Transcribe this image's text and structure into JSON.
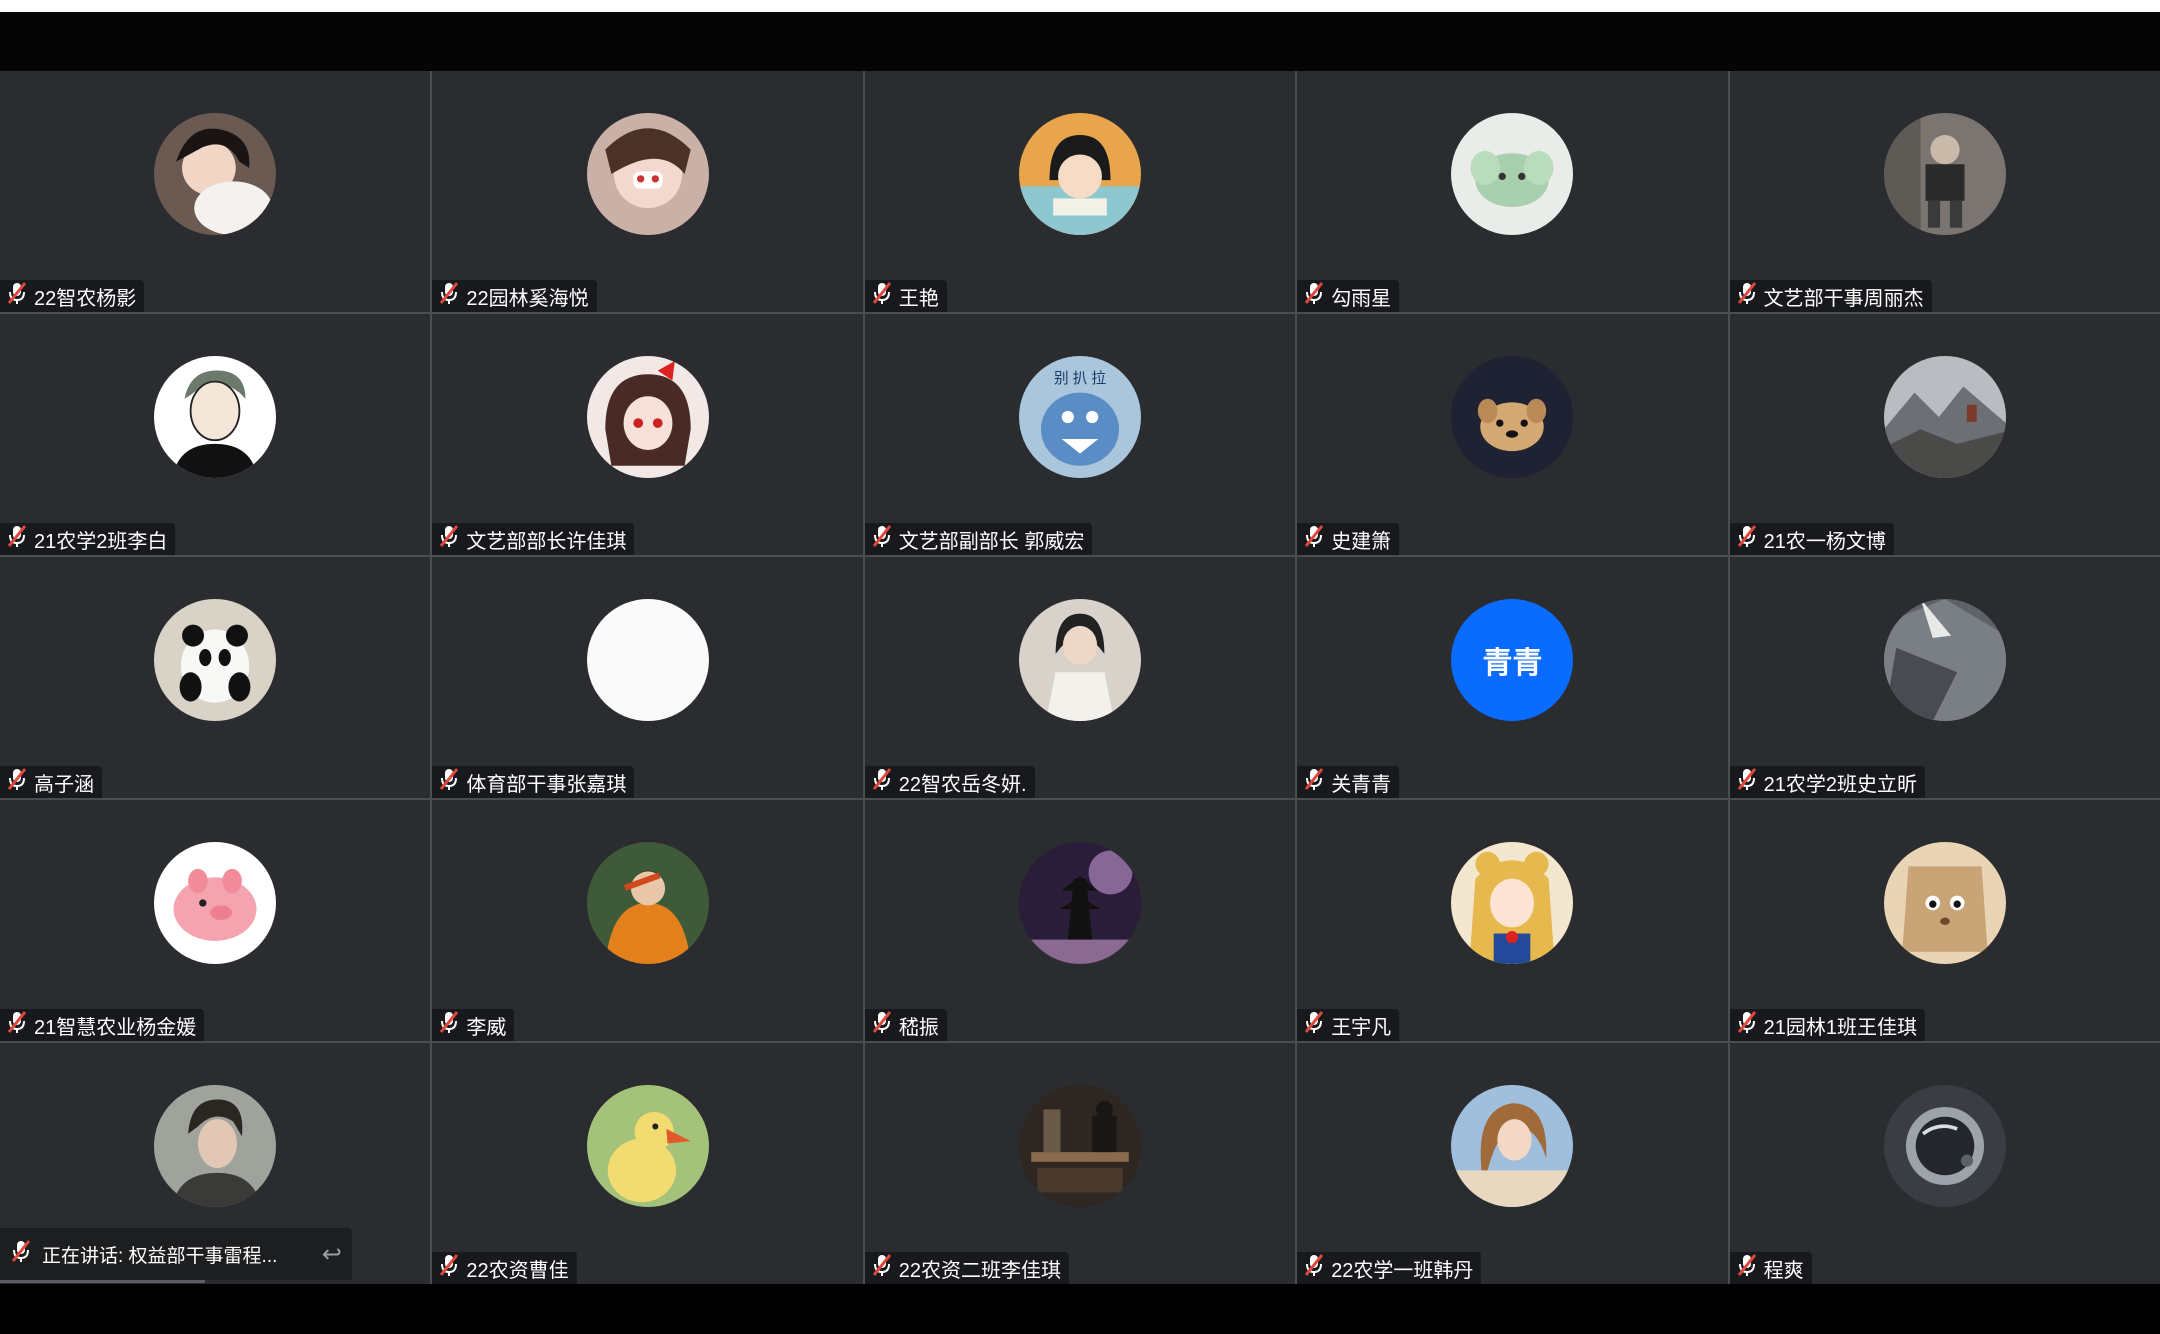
{
  "colors": {
    "tile_bg": "#2a2c30",
    "mic_muted": "#e0473c",
    "text_avatar_bg": "#0a6cff"
  },
  "participants": [
    {
      "name": "22智农杨影",
      "avatar": "photo-girl"
    },
    {
      "name": "22园林奚海悦",
      "avatar": "photo-girl-sticker"
    },
    {
      "name": "王艳",
      "avatar": "cartoon-maruko"
    },
    {
      "name": "勾雨星",
      "avatar": "cartoon-green-elephant"
    },
    {
      "name": "文艺部干事周丽杰",
      "avatar": "photo-person-sitting"
    },
    {
      "name": "21农学2班李白",
      "avatar": "cartoon-zoro"
    },
    {
      "name": "文艺部部长许佳琪",
      "avatar": "anime-girl-red-bow"
    },
    {
      "name": "文艺部副部长 郭威宏",
      "avatar": "cartoon-blue-dino"
    },
    {
      "name": "史建箫",
      "avatar": "cartoon-dark-dog"
    },
    {
      "name": "21农一杨文博",
      "avatar": "photo-mountains"
    },
    {
      "name": "高子涵",
      "avatar": "photo-panda"
    },
    {
      "name": "体育部干事张嘉琪",
      "avatar": "blank-white"
    },
    {
      "name": "22智农岳冬妍.",
      "avatar": "photo-girl-room"
    },
    {
      "name": "关青青",
      "avatar": "text",
      "avatar_text": "青青"
    },
    {
      "name": "21农学2班史立昕",
      "avatar": "photo-fabric"
    },
    {
      "name": "21智慧农业杨金媛",
      "avatar": "cartoon-pink-pig"
    },
    {
      "name": "李威",
      "avatar": "photo-orange-hoodie"
    },
    {
      "name": "嵇振",
      "avatar": "photo-pagoda-night"
    },
    {
      "name": "王宇凡",
      "avatar": "anime-sailor-moon"
    },
    {
      "name": "21园林1班王佳琪",
      "avatar": "cartoon-paper-bag"
    },
    {
      "name": "",
      "avatar": "photo-boy"
    },
    {
      "name": "22农资曹佳",
      "avatar": "cartoon-yellow-duck"
    },
    {
      "name": "22农资二班李佳琪",
      "avatar": "photo-cafe"
    },
    {
      "name": "22农学一班韩丹",
      "avatar": "photo-girl-windy"
    },
    {
      "name": "程爽",
      "avatar": "photo-astronaut"
    }
  ],
  "speaking_indicator": {
    "text": "正在讲话: 权益部干事雷程..."
  }
}
